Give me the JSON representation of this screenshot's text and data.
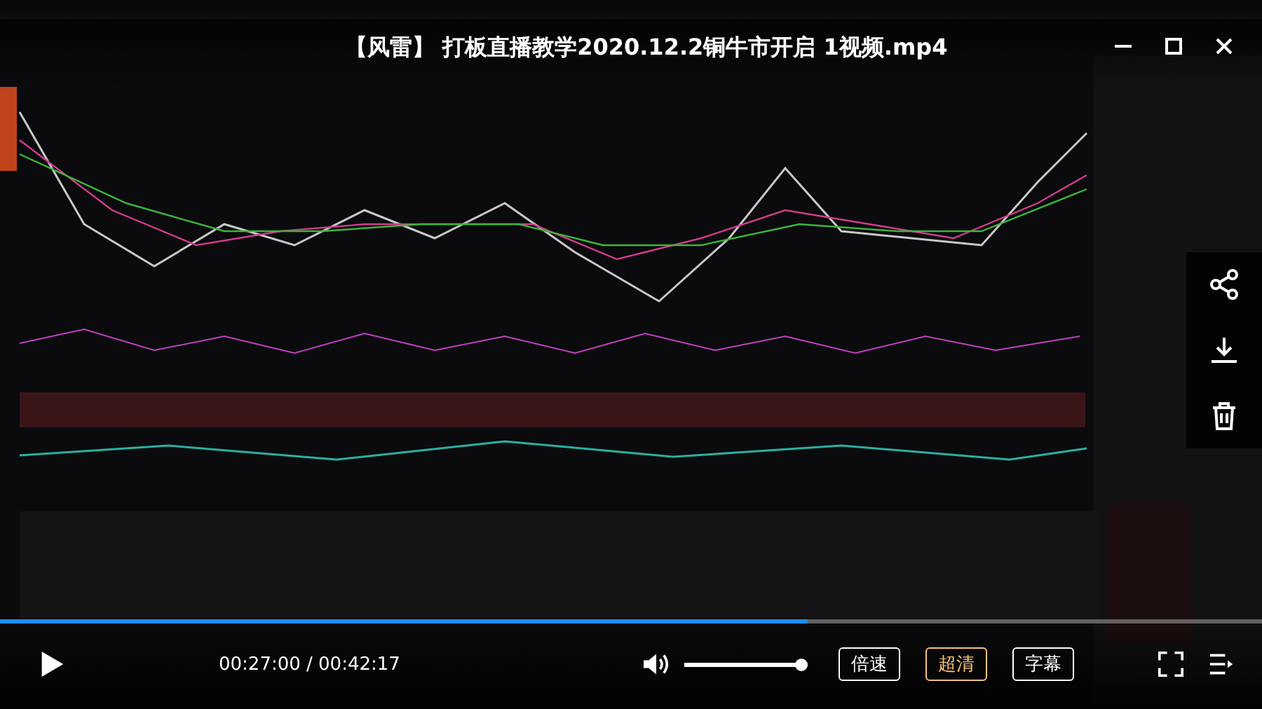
{
  "window": {
    "title": "【风雷】 打板直播教学2020.12.2铜牛市开启 1视频.mp4"
  },
  "player": {
    "progress": {
      "level": 0.64
    },
    "time": "00:27:00 / 00:42:17",
    "volume": {
      "level": 0.94
    },
    "buttons": [
      {
        "label": "倍速",
        "selected": false
      },
      {
        "label": "超清",
        "selected": true
      },
      {
        "label": "字幕",
        "selected": false
      }
    ]
  }
}
